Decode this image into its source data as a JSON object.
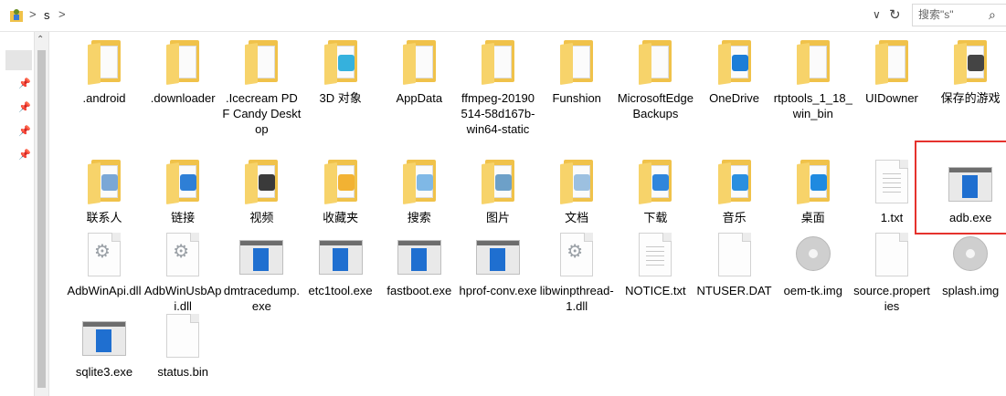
{
  "address": {
    "path_segment": "s",
    "breadcrumb_separator": ">",
    "dropdown_glyph": "∨",
    "refresh_glyph": "↻",
    "search_placeholder": "搜索\"s\"",
    "search_icon": "⌕"
  },
  "nav": {
    "pins": [
      "📌",
      "📌",
      "📌",
      "📌"
    ],
    "scroll_up_glyph": "⌃"
  },
  "items": [
    {
      "label": ".android",
      "icon": "folder-icon",
      "type": "folder"
    },
    {
      "label": ".downloader",
      "icon": "folder-icon",
      "type": "folder"
    },
    {
      "label": ".Icecream PDF Candy Desktop",
      "icon": "folder-icon",
      "type": "folder"
    },
    {
      "label": "3D 对象",
      "icon": "3d-objects-folder-icon",
      "type": "folder",
      "badge": "#35b1dd"
    },
    {
      "label": "AppData",
      "icon": "folder-icon",
      "type": "folder"
    },
    {
      "label": "ffmpeg-20190514-58d167b-win64-static",
      "icon": "folder-icon",
      "type": "folder"
    },
    {
      "label": "Funshion",
      "icon": "folder-icon",
      "type": "folder"
    },
    {
      "label": "MicrosoftEdgeBackups",
      "icon": "folder-icon",
      "type": "folder"
    },
    {
      "label": "OneDrive",
      "icon": "onedrive-folder-icon",
      "type": "folder",
      "badge": "#1d7ed8"
    },
    {
      "label": "rtptools_1_18_win_bin",
      "icon": "folder-icon",
      "type": "folder"
    },
    {
      "label": "UIDowner",
      "icon": "folder-icon",
      "type": "folder"
    },
    {
      "label": "保存的游戏",
      "icon": "saved-games-folder-icon",
      "type": "folder",
      "badge": "#444444"
    },
    {
      "label": "联系人",
      "icon": "contacts-folder-icon",
      "type": "folder",
      "badge": "#7aa7d6"
    },
    {
      "label": "链接",
      "icon": "links-folder-icon",
      "type": "folder",
      "badge": "#2e7fd6"
    },
    {
      "label": "视频",
      "icon": "videos-folder-icon",
      "type": "folder",
      "badge": "#3a3a3a"
    },
    {
      "label": "收藏夹",
      "icon": "favorites-folder-icon",
      "type": "folder",
      "badge": "#f2b233"
    },
    {
      "label": "搜索",
      "icon": "searches-folder-icon",
      "type": "folder",
      "badge": "#7fb8e6"
    },
    {
      "label": "图片",
      "icon": "pictures-folder-icon",
      "type": "folder",
      "badge": "#6da0c8"
    },
    {
      "label": "文档",
      "icon": "documents-folder-icon",
      "type": "folder",
      "badge": "#9cc0e0"
    },
    {
      "label": "下载",
      "icon": "downloads-folder-icon",
      "type": "folder",
      "badge": "#2f86dc"
    },
    {
      "label": "音乐",
      "icon": "music-folder-icon",
      "type": "folder",
      "badge": "#2a8fe0"
    },
    {
      "label": "桌面",
      "icon": "desktop-folder-icon",
      "type": "folder",
      "badge": "#1f8ae0"
    },
    {
      "label": "1.txt",
      "icon": "text-file-icon",
      "type": "doc"
    },
    {
      "label": "adb.exe",
      "icon": "exe-file-icon",
      "type": "exe"
    },
    {
      "label": "AdbWinApi.dll",
      "icon": "dll-file-icon",
      "type": "dll"
    },
    {
      "label": "AdbWinUsbApi.dll",
      "icon": "dll-file-icon",
      "type": "dll"
    },
    {
      "label": "dmtracedump.exe",
      "icon": "exe-file-icon",
      "type": "exe"
    },
    {
      "label": "etc1tool.exe",
      "icon": "exe-file-icon",
      "type": "exe"
    },
    {
      "label": "fastboot.exe",
      "icon": "exe-file-icon",
      "type": "exe"
    },
    {
      "label": "hprof-conv.exe",
      "icon": "exe-file-icon",
      "type": "exe"
    },
    {
      "label": "libwinpthread-1.dll",
      "icon": "dll-file-icon",
      "type": "dll"
    },
    {
      "label": "NOTICE.txt",
      "icon": "text-file-icon",
      "type": "doc"
    },
    {
      "label": "NTUSER.DAT",
      "icon": "generic-file-icon",
      "type": "doc"
    },
    {
      "label": "oem-tk.img",
      "icon": "disc-image-icon",
      "type": "disc"
    },
    {
      "label": "source.properties",
      "icon": "generic-file-icon",
      "type": "doc"
    },
    {
      "label": "splash.img",
      "icon": "disc-image-icon",
      "type": "disc"
    },
    {
      "label": "sqlite3.exe",
      "icon": "exe-file-icon",
      "type": "exe"
    },
    {
      "label": "status.bin",
      "icon": "generic-file-icon",
      "type": "doc"
    }
  ],
  "highlighted_item": "adb.exe",
  "colors": {
    "highlight_border": "#e5322d",
    "folder": "#f0c24a",
    "exe_panel": "#1f6fd0"
  }
}
